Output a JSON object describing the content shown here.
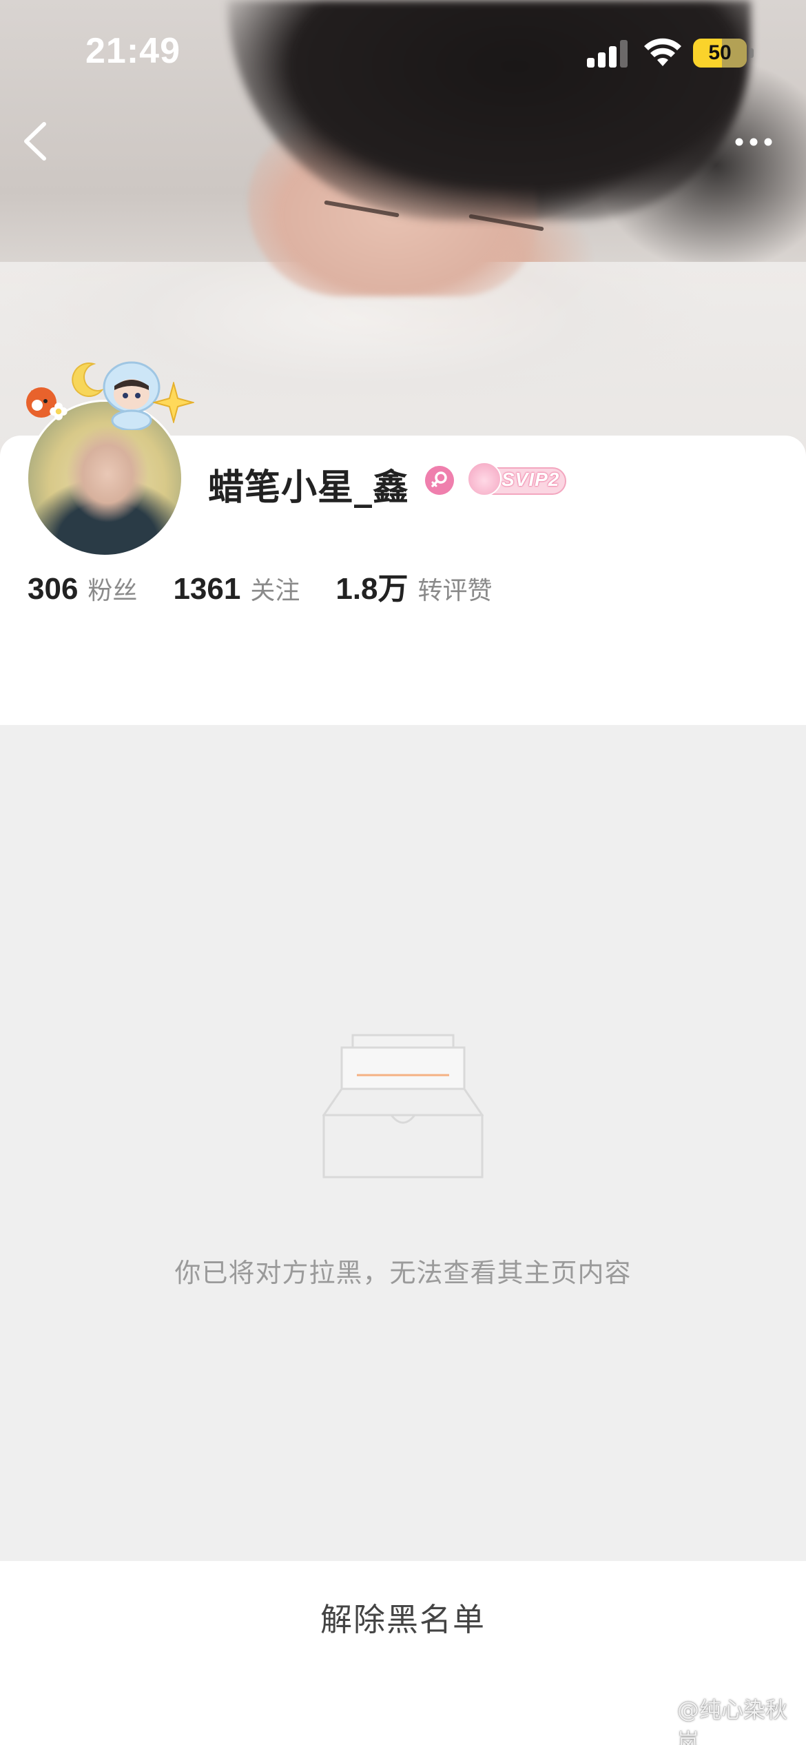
{
  "status_bar": {
    "time": "21:49",
    "battery_level": "50",
    "signal_bars_active": 3,
    "signal_bars_total": 4
  },
  "nav": {
    "back_icon": "chevron-left-icon",
    "more_icon": "more-dots-icon"
  },
  "profile": {
    "username": "蜡笔小星_鑫",
    "gender_icon": "female-gender-icon",
    "vip_badge": "SVIP2",
    "stats": [
      {
        "value": "306",
        "label": "粉丝"
      },
      {
        "value": "1361",
        "label": "关注"
      },
      {
        "value": "1.8万",
        "label": "转评赞"
      }
    ]
  },
  "blocked": {
    "message": "你已将对方拉黑，无法查看其主页内容",
    "illustration_icon": "empty-inbox-icon"
  },
  "actions": {
    "unblock_label": "解除黑名单"
  },
  "watermark": {
    "text": "@纯心染秋岚",
    "logo_icon": "weibo-logo-icon"
  },
  "colors": {
    "page_background": "#efefef",
    "card_background": "#ffffff",
    "battery": "#fad32b",
    "gender_badge": "#ef7fad",
    "vip_pink": "#fbd6e2",
    "illustration_accent": "#f5b183"
  }
}
